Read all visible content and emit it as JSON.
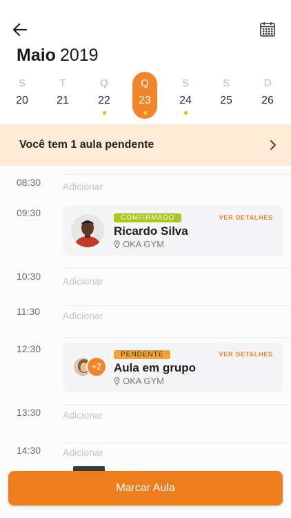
{
  "header": {
    "back_icon": "arrow-left-icon",
    "calendar_icon": "calendar-grid-icon",
    "month": "Maio",
    "year": "2019"
  },
  "week": {
    "days": [
      {
        "weekday": "S",
        "date": "20",
        "has_event": false,
        "selected": false
      },
      {
        "weekday": "T",
        "date": "21",
        "has_event": false,
        "selected": false
      },
      {
        "weekday": "Q",
        "date": "22",
        "has_event": true,
        "selected": false
      },
      {
        "weekday": "Q",
        "date": "23",
        "has_event": true,
        "selected": true
      },
      {
        "weekday": "S",
        "date": "24",
        "has_event": true,
        "selected": false
      },
      {
        "weekday": "S",
        "date": "25",
        "has_event": false,
        "selected": false
      },
      {
        "weekday": "D",
        "date": "26",
        "has_event": false,
        "selected": false
      }
    ],
    "event_dot_color": "#f2b600"
  },
  "banner": {
    "text": "Você tem 1 aula pendente",
    "background": "#fdebd6"
  },
  "schedule": {
    "add_label": "Adicionar",
    "slots": [
      {
        "time": "08:30"
      },
      {
        "time": "09:30"
      },
      {
        "time": "10:30"
      },
      {
        "time": "11:30"
      },
      {
        "time": "12:30"
      },
      {
        "time": "13:30"
      },
      {
        "time": "14:30"
      }
    ],
    "cards": [
      {
        "status": "CONFIRMADO",
        "name": "Ricardo Silva",
        "location": "OKA GYM",
        "details": "VER DETALHES"
      },
      {
        "status": "PENDENTE",
        "name": "Aula em grupo",
        "location": "OKA GYM",
        "details": "VER DETALHES",
        "extra_count": "+2"
      }
    ]
  },
  "cta": {
    "label": "Marcar Aula",
    "color": "#ee7d1b"
  },
  "colors": {
    "accent": "#f2842a",
    "confirmed": "#a8c81b",
    "pending": "#f0a53a"
  }
}
